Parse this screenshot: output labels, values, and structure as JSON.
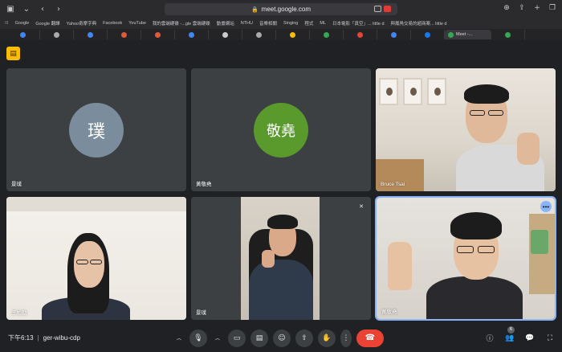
{
  "browser": {
    "url": "meet.google.com",
    "bookmarks": [
      "Google",
      "Google 翻譯",
      "Yahoo奇摩字典",
      "Facebook",
      "YouTube",
      "我的雲端硬碟 -...gle 雲端硬碟",
      "動畫網站",
      "NTHU",
      "音樂相關",
      "Singing",
      "程式",
      "ML",
      "日本電影「真空」... little d",
      "與鳳鳧交易的超商案... little d"
    ],
    "active_tab_label": "Meet -..."
  },
  "meet": {
    "participants": [
      {
        "name": "景璞",
        "avatar_text": "璞",
        "avatar_color": "#7b8d9c"
      },
      {
        "name": "黃敬堯",
        "avatar_text": "敬堯",
        "avatar_color": "#5a9a2d"
      },
      {
        "name": "Bruce Tsai"
      },
      {
        "name": "王柏勳"
      },
      {
        "name": "景璞"
      },
      {
        "name": "黃敬堯"
      }
    ],
    "time": "下午6:13",
    "meeting_code": "ger-wibu-cdp",
    "people_count": "6"
  },
  "colors": {
    "hangup": "#ea4335",
    "active_outline": "#8ab4f8",
    "badge": "#fbbc04"
  }
}
